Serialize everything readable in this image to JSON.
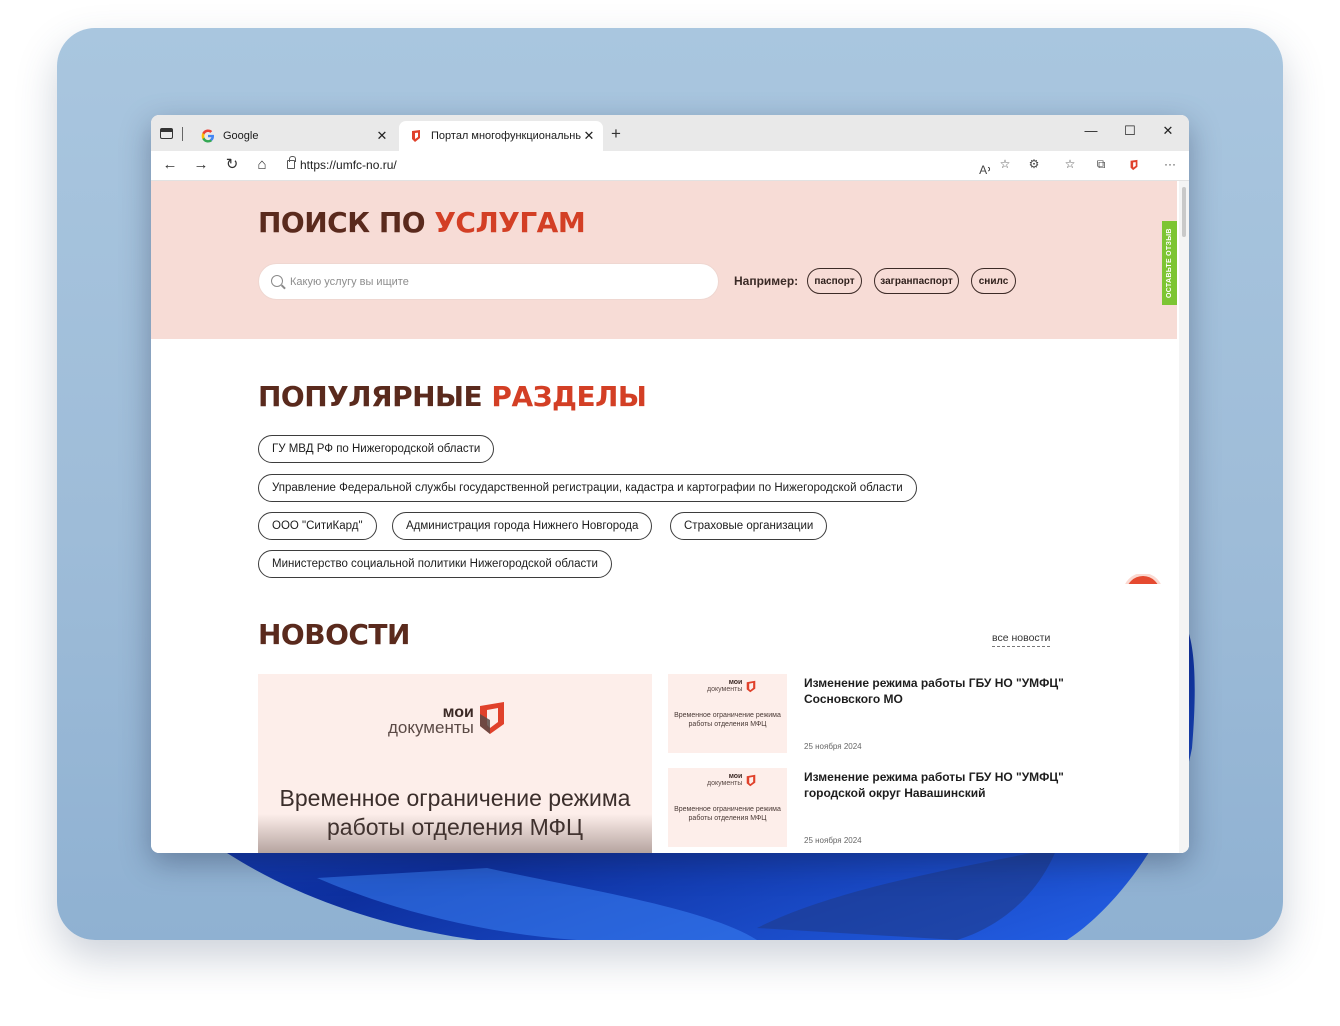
{
  "browser": {
    "tabs": [
      {
        "title": "Google",
        "active": false,
        "favicon": "google-icon"
      },
      {
        "title": "Портал многофункциональных",
        "active": true,
        "favicon": "umfc-icon"
      }
    ],
    "url": "https://umfc-no.ru/"
  },
  "search_section": {
    "title_part1": "ПОИСК ПО",
    "title_part2": "УСЛУГАМ",
    "placeholder": "Какую услугу вы ищите",
    "example_label": "Например:",
    "examples": [
      "паспорт",
      "загранпаспорт",
      "снилс"
    ],
    "feedback": "ОСТАВЬТЕ ОТЗЫВ"
  },
  "popular": {
    "title_part1": "ПОПУЛЯРНЫЕ",
    "title_part2": "РАЗДЕЛЫ",
    "items": [
      "ГУ МВД РФ по Нижегородской области",
      "Управление Федеральной службы государственной регистрации, кадастра и картографии по Нижегородской области",
      "ООО \"СитиКард\"",
      "Администрация города Нижнего Новгорода",
      "Страховые организации",
      "Министерство социальной политики Нижегородской области"
    ]
  },
  "news": {
    "title": "НОВОСТИ",
    "all_link": "все новости",
    "brand_top": "мои",
    "brand_bottom": "документы",
    "featured_caption": "Временное ограничение режима работы отделения МФЦ",
    "thumb_caption": "Временное ограничение режима работы отделения МФЦ",
    "items": [
      {
        "title": "Изменение режима работы ГБУ НО \"УМФЦ\" Сосновского МО",
        "date": "25 ноября 2024"
      },
      {
        "title": "Изменение режима работы ГБУ НО \"УМФЦ\" городской округ Навашинский",
        "date": "25 ноября 2024"
      }
    ]
  },
  "colors": {
    "hero_bg": "#f7dcd6",
    "title_dark": "#5a2a1d",
    "title_accent": "#d33f25",
    "feedback_green": "#7dc533"
  }
}
